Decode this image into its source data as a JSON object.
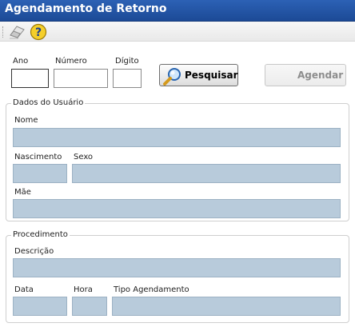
{
  "window": {
    "title": "Agendamento de Retorno"
  },
  "toolbar": {
    "clear_icon": "eraser-icon",
    "help_icon": "help-icon",
    "help_glyph": "?"
  },
  "search": {
    "ano_label": "Ano",
    "ano_value": "",
    "numero_label": "Número",
    "numero_value": "",
    "digito_label": "Dígito",
    "digito_value": "",
    "search_button": "Pesquisar",
    "search_icon": "magnifier-icon",
    "schedule_button": "Agendar"
  },
  "user_section": {
    "legend": "Dados do Usuário",
    "nome_label": "Nome",
    "nome_value": "",
    "nascimento_label": "Nascimento",
    "nascimento_value": "",
    "sexo_label": "Sexo",
    "sexo_value": "",
    "mae_label": "Mãe",
    "mae_value": ""
  },
  "procedure_section": {
    "legend": "Procedimento",
    "descricao_label": "Descrição",
    "descricao_value": "",
    "data_label": "Data",
    "data_value": "",
    "hora_label": "Hora",
    "hora_value": "",
    "tipo_label": "Tipo Agendamento",
    "tipo_value": ""
  },
  "colors": {
    "titlebar": "#2c61b5",
    "field_bg": "#b8cbdb",
    "disabled_text": "#8d8d8d"
  }
}
